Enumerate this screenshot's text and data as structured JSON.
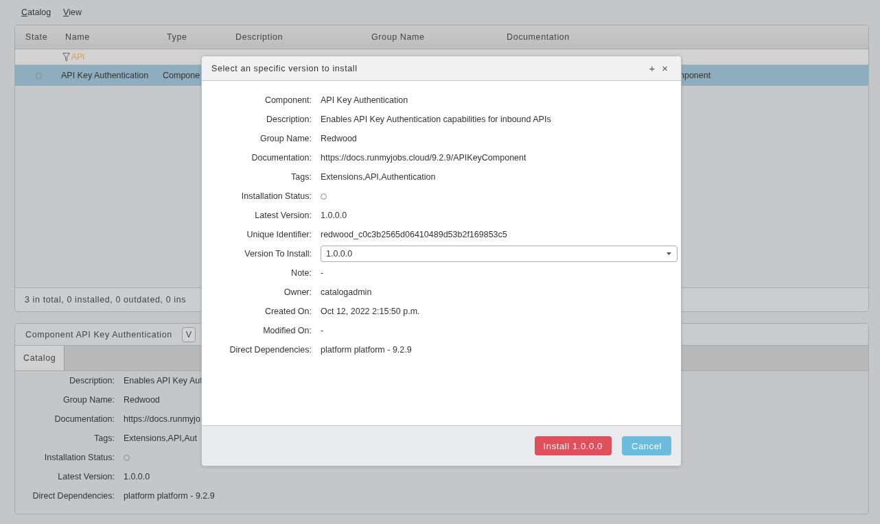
{
  "menu": [
    {
      "label": "Catalog"
    },
    {
      "label": "View"
    }
  ],
  "table": {
    "columns": [
      "State",
      "Name",
      "Type",
      "Description",
      "Group Name",
      "Documentation"
    ],
    "filter": "API",
    "rows": [
      {
        "selected": true,
        "name": "API Key Authentication",
        "type": "Compone",
        "column_6": "nponent"
      }
    ],
    "status_bar": "3 in total, 0 installed, 0 outdated, 0 ins"
  },
  "details": {
    "title": "Component API Key Authentication",
    "button": "V",
    "tabs": [
      {
        "label": "Catalog",
        "selected": true
      }
    ],
    "fields": [
      {
        "kind": "text",
        "label": "Description:",
        "value": "Enables API Key Aut"
      },
      {
        "kind": "text",
        "label": "Group Name:",
        "value": "Redwood"
      },
      {
        "kind": "text",
        "label": "Documentation:",
        "value": "https://docs.runmyjo"
      },
      {
        "kind": "text",
        "label": "Tags:",
        "value": "Extensions,API,Aut"
      },
      {
        "kind": "status",
        "label": "Installation Status:"
      },
      {
        "kind": "text",
        "label": "Latest Version:",
        "value": "1.0.0.0"
      },
      {
        "kind": "text",
        "label": "Direct Dependencies:",
        "value": "platform platform - 9.2.9"
      }
    ]
  },
  "dialog": {
    "title": "Select an specific version to install",
    "controls": [
      "+",
      "×"
    ],
    "fields": [
      {
        "kind": "text",
        "label": "Component:",
        "value": "API Key Authentication"
      },
      {
        "kind": "text",
        "label": "Description:",
        "value": "Enables API Key Authentication capabilities for inbound APIs"
      },
      {
        "kind": "text",
        "label": "Group Name:",
        "value": "Redwood"
      },
      {
        "kind": "text",
        "label": "Documentation:",
        "value": "https://docs.runmyjobs.cloud/9.2.9/APIKeyComponent"
      },
      {
        "kind": "text",
        "label": "Tags:",
        "value": "Extensions,API,Authentication"
      },
      {
        "kind": "status",
        "label": "Installation Status:"
      },
      {
        "kind": "text",
        "label": "Latest Version:",
        "value": "1.0.0.0"
      },
      {
        "kind": "text",
        "label": "Unique Identifier:",
        "value": "redwood_c0c3b2565d06410489d53b2f169853c5"
      },
      {
        "kind": "select",
        "label": "Version To Install:",
        "value": "1.0.0.0"
      },
      {
        "kind": "text",
        "label": "Note:",
        "value": "-"
      },
      {
        "kind": "text",
        "label": "Owner:",
        "value": "catalogadmin"
      },
      {
        "kind": "text",
        "label": "Created On:",
        "value": "Oct 12, 2022 2:15:50 p.m."
      },
      {
        "kind": "text",
        "label": "Modified On:",
        "value": "-"
      },
      {
        "kind": "text",
        "label": "Direct Dependencies:",
        "value": "platform platform - 9.2.9"
      }
    ],
    "buttons": [
      {
        "kind": "primary",
        "label": "Install 1.0.0.0"
      },
      {
        "kind": "secondary",
        "label": "Cancel"
      }
    ]
  }
}
